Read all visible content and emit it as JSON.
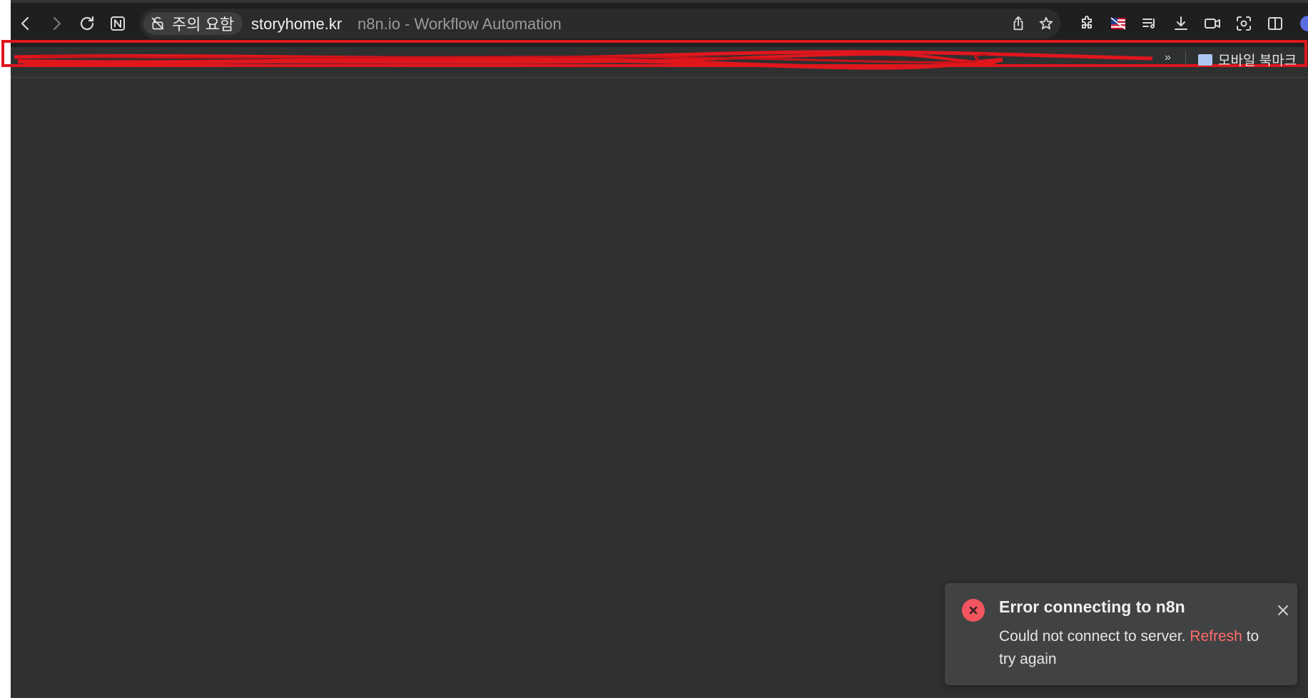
{
  "browser": {
    "security_chip_label": "주의 요함",
    "url_host": "storyhome.kr",
    "tab_title": "n8n.io - Workflow Automation",
    "icons": {
      "back": "chevron-left-icon",
      "forward": "chevron-right-icon",
      "reload": "reload-icon",
      "site": "n-logo-icon",
      "security": "not-secure-icon",
      "share": "share-icon",
      "bookmark": "star-icon",
      "extensions": "puzzle-icon",
      "flag": "us-flag-icon",
      "queue": "playlist-icon",
      "download": "download-icon",
      "camera": "video-camera-icon",
      "screenshot": "screenshot-icon",
      "split": "split-view-icon"
    }
  },
  "bookmarks_bar": {
    "overflow_label": "»",
    "mobile_folder_label": "모바일 북마크"
  },
  "toast": {
    "title": "Error connecting to n8n",
    "message_prefix": "Could not connect to server. ",
    "message_link": "Refresh",
    "message_suffix": " to try again",
    "icon": "error-x-icon",
    "close_icon": "close-icon"
  },
  "colors": {
    "canvas_bg": "#2f3030",
    "toolbar_bg": "#1f1f1f",
    "error_red": "#f2555f",
    "link_red": "#ff6b6b",
    "redaction_red": "#e0161d"
  }
}
